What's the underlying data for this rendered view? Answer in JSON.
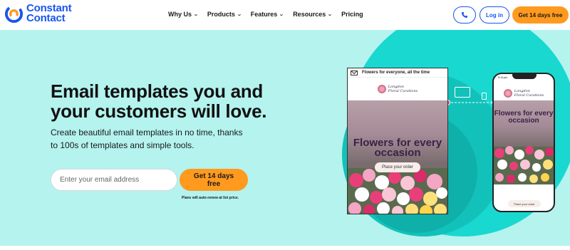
{
  "brand": {
    "line1": "Constant",
    "line2": "Contact"
  },
  "nav": {
    "items": [
      {
        "label": "Why Us",
        "has_dropdown": true
      },
      {
        "label": "Products",
        "has_dropdown": true
      },
      {
        "label": "Features",
        "has_dropdown": true
      },
      {
        "label": "Resources",
        "has_dropdown": true
      },
      {
        "label": "Pricing",
        "has_dropdown": false
      }
    ],
    "phone_icon": "phone-icon",
    "login_label": "Log in",
    "trial_label": "Get 14 days free"
  },
  "hero": {
    "headline": "Email templates you and your customers will love.",
    "subheadline": "Create beautiful email templates in no time, thanks to 100s of templates and simple tools.",
    "email_placeholder": "Enter your email address",
    "cta_label": "Get 14 days free",
    "note": "Plans will auto-renew at list price."
  },
  "email_preview": {
    "subject": "Flowers for everyone, all the time",
    "brand_line1": "Longdon",
    "brand_line2": "Floral Curations",
    "title": "Flowers for every occasion",
    "button": "Place your order"
  },
  "phone_preview": {
    "time": "9:41pm",
    "title": "Flowers for every occasion",
    "button": "Place your order"
  },
  "colors": {
    "brand_blue": "#1856ed",
    "brand_orange": "#ff9a1f",
    "hero_bg": "#b4f3ee",
    "circle_teal": "#19d8d0",
    "circle_dark": "#10b5ae"
  }
}
